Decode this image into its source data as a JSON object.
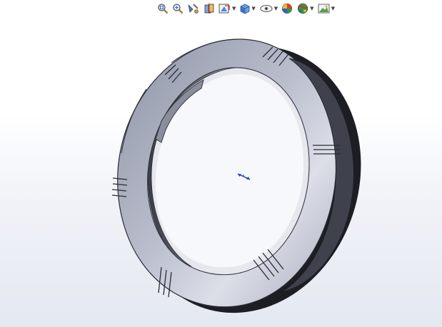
{
  "window": {
    "background_top": "#ffffff",
    "background_bottom": "#e4e8f0"
  },
  "toolbar": {
    "buttons": [
      {
        "name": "zoom-to-fit",
        "icon": "zoom-to-fit-icon",
        "dropdown": false
      },
      {
        "name": "zoom-to-area",
        "icon": "zoom-to-area-icon",
        "dropdown": false
      },
      {
        "name": "previous-view",
        "icon": "previous-view-icon",
        "dropdown": false
      },
      {
        "name": "section-view",
        "icon": "section-view-icon",
        "dropdown": false
      },
      {
        "name": "view-orientation",
        "icon": "view-orientation-icon",
        "dropdown": true
      },
      {
        "name": "display-style",
        "icon": "display-style-icon",
        "dropdown": true
      },
      {
        "name": "hide-show-items",
        "icon": "hide-show-items-icon",
        "dropdown": true
      },
      {
        "name": "edit-appearance",
        "icon": "edit-appearance-icon",
        "dropdown": false
      },
      {
        "name": "apply-scene",
        "icon": "apply-scene-icon",
        "dropdown": true
      },
      {
        "name": "view-settings",
        "icon": "view-settings-icon",
        "dropdown": true
      }
    ]
  },
  "model": {
    "part": "ring",
    "colors": {
      "face": "#a8adbd",
      "face_light": "#d9dbe6",
      "edge": "#2a2d36",
      "side": "#5a5e6b",
      "dark": "#1a1c22"
    }
  },
  "triad": {
    "color": "#1e2fd0"
  }
}
